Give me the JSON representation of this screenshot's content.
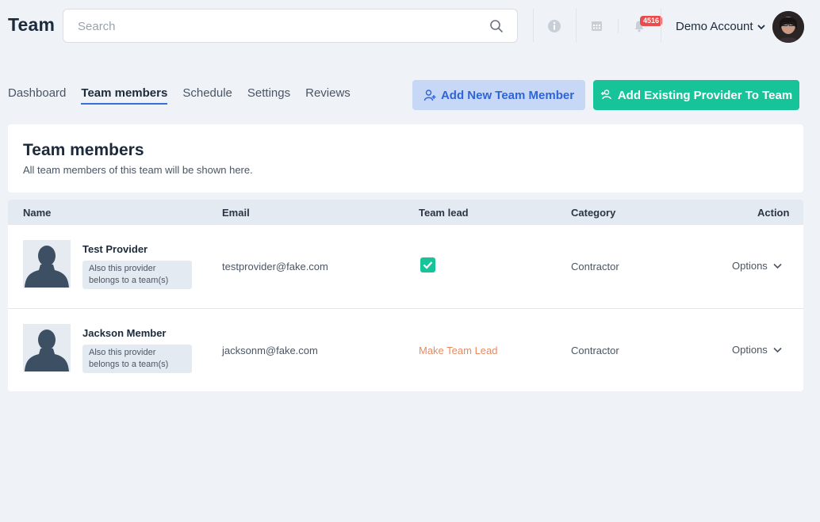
{
  "header": {
    "title": "Team",
    "search_placeholder": "Search",
    "notification_count": "4516",
    "account_name": "Demo Account"
  },
  "tabs": [
    {
      "label": "Dashboard",
      "active": false
    },
    {
      "label": "Team members",
      "active": true
    },
    {
      "label": "Schedule",
      "active": false
    },
    {
      "label": "Settings",
      "active": false
    },
    {
      "label": "Reviews",
      "active": false
    }
  ],
  "actions": {
    "add_new": "Add New Team Member",
    "add_existing": "Add Existing Provider To Team"
  },
  "section": {
    "title": "Team members",
    "subtitle": "All team members of this team will be shown here."
  },
  "table": {
    "columns": {
      "name": "Name",
      "email": "Email",
      "team_lead": "Team lead",
      "category": "Category",
      "action": "Action"
    },
    "rows": [
      {
        "name": "Test Provider",
        "note": "Also this provider belongs to a team(s)",
        "email": "testprovider@fake.com",
        "team_lead": true,
        "team_lead_action": "",
        "category": "Contractor",
        "action_label": "Options"
      },
      {
        "name": "Jackson Member",
        "note": "Also this provider belongs to a team(s)",
        "email": "jacksonm@fake.com",
        "team_lead": false,
        "team_lead_action": "Make Team Lead",
        "category": "Contractor",
        "action_label": "Options"
      }
    ]
  },
  "colors": {
    "accent_blue": "#2f64d6",
    "accent_green": "#17c49a",
    "make_lead": "#ea8a62",
    "badge": "#e84c4c"
  }
}
